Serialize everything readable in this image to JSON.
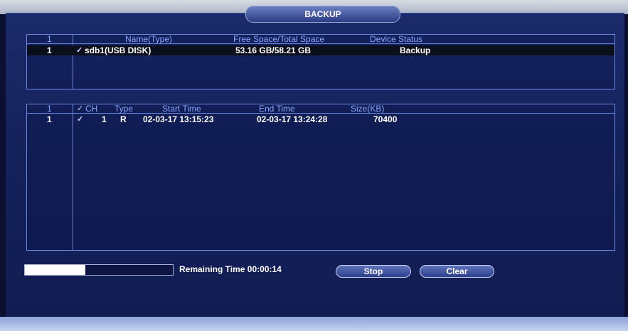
{
  "window": {
    "title": "BACKUP"
  },
  "devices": {
    "header": {
      "index": "1",
      "name": "Name(Type)",
      "space": "Free Space/Total Space",
      "status": "Device Status"
    },
    "rows": [
      {
        "index": "1",
        "checked": true,
        "name": "sdb1(USB DISK)",
        "space": "53.16 GB/58.21 GB",
        "status": "Backup"
      }
    ]
  },
  "files": {
    "header": {
      "index": "1",
      "ch": "CH",
      "type": "Type",
      "start": "Start Time",
      "end": "End Time",
      "size": "Size(KB)"
    },
    "rows": [
      {
        "index": "1",
        "checked": true,
        "ch": "1",
        "type": "R",
        "start": "02-03-17 13:15:23",
        "end": "02-03-17 13:24:28",
        "size": "70400"
      }
    ]
  },
  "progress": {
    "fraction": 0.41,
    "remaining_label": "Remaining Time 00:00:14"
  },
  "buttons": {
    "stop": "Stop",
    "clear": "Clear"
  },
  "colors": {
    "header_text": "#8aa6ff",
    "border": "#6b86d8",
    "panel": "#15225c"
  }
}
